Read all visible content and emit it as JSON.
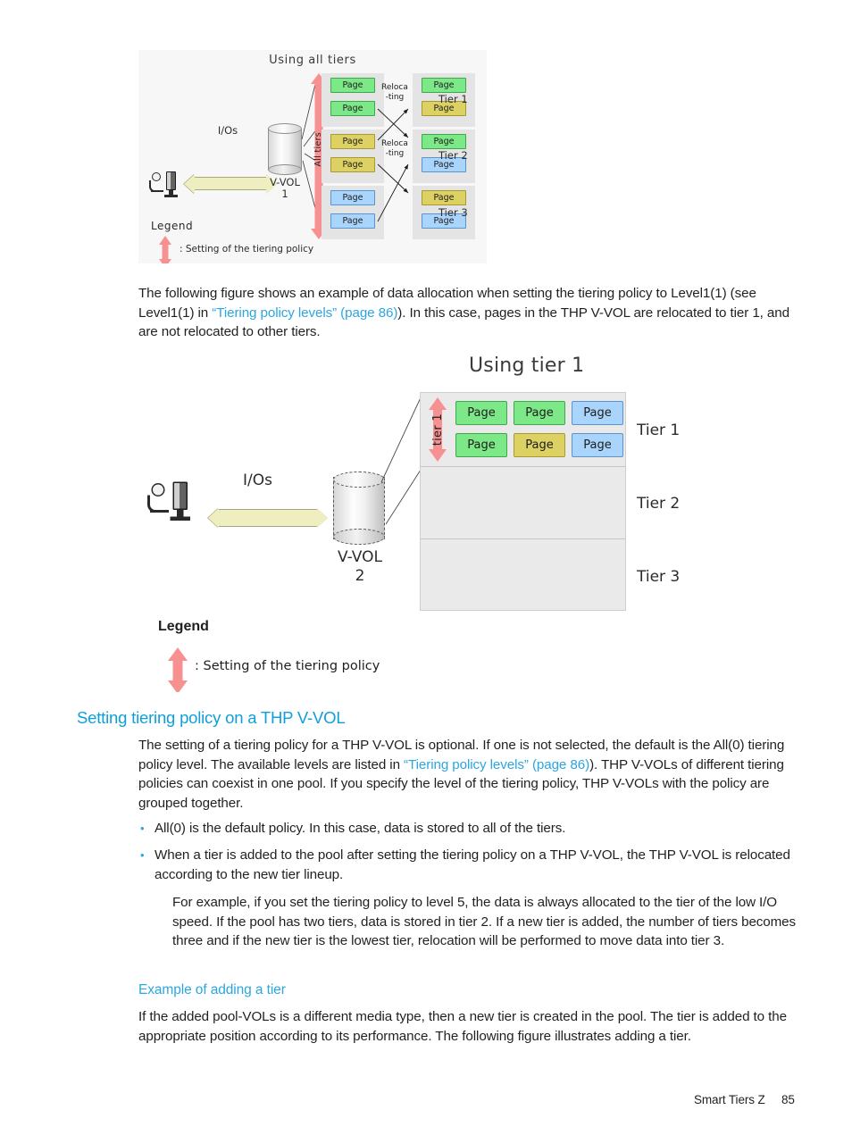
{
  "document": {
    "footer_label": "Smart Tiers Z",
    "page_number": "85"
  },
  "figure1": {
    "title": "Using all tiers",
    "io_label": "I/Os",
    "volume_name": "V-VOL",
    "volume_number": "1",
    "policy_label": "All tiers",
    "relocating_label_1": "Reloca\n-ting",
    "relocating_label_2": "Reloca\n-ting",
    "tier_labels": [
      "Tier 1",
      "Tier 2",
      "Tier 3"
    ],
    "page_label": "Page",
    "left_stack": [
      {
        "tier": 1,
        "pages": [
          {
            "label": "Page",
            "color": "green"
          },
          {
            "label": "Page",
            "color": "green"
          }
        ]
      },
      {
        "tier": 2,
        "pages": [
          {
            "label": "Page",
            "color": "gold"
          },
          {
            "label": "Page",
            "color": "gold"
          }
        ]
      },
      {
        "tier": 3,
        "pages": [
          {
            "label": "Page",
            "color": "blue"
          },
          {
            "label": "Page",
            "color": "blue"
          }
        ]
      }
    ],
    "right_stack": [
      {
        "tier": 1,
        "pages": [
          {
            "label": "Page",
            "color": "green"
          },
          {
            "label": "Page",
            "color": "gold"
          }
        ]
      },
      {
        "tier": 2,
        "pages": [
          {
            "label": "Page",
            "color": "green"
          },
          {
            "label": "Page",
            "color": "blue"
          }
        ]
      },
      {
        "tier": 3,
        "pages": [
          {
            "label": "Page",
            "color": "gold"
          },
          {
            "label": "Page",
            "color": "blue"
          }
        ]
      }
    ],
    "legend_title": "Legend",
    "legend_entry": ": Setting of the tiering policy"
  },
  "figure2": {
    "title": "Using tier 1",
    "io_label": "I/Os",
    "volume_name": "V-VOL",
    "volume_number": "2",
    "policy_label": "tier 1",
    "tier_labels": [
      "Tier 1",
      "Tier 2",
      "Tier 3"
    ],
    "tier1_pages": [
      {
        "label": "Page",
        "color": "green"
      },
      {
        "label": "Page",
        "color": "green"
      },
      {
        "label": "Page",
        "color": "blue"
      },
      {
        "label": "Page",
        "color": "green"
      },
      {
        "label": "Page",
        "color": "gold"
      },
      {
        "label": "Page",
        "color": "blue"
      }
    ],
    "legend_title": "Legend",
    "legend_entry": ": Setting of the tiering policy"
  },
  "paragraphs": {
    "intro_1": "The following figure shows an example of data allocation when setting the tiering policy to Level1(1) (see Level1(1) in ",
    "intro_link": "“Tiering policy levels” (page 86)",
    "intro_2": "). In this case, pages in the THP V-VOL are relocated to tier 1, and are not relocated to other tiers."
  },
  "section": {
    "heading": "Setting tiering policy on a THP V-VOL",
    "body_1": "The setting of a tiering policy for a THP V-VOL is optional. If one is not selected, the default is the All(0) tiering policy level. The available levels are listed in ",
    "body_link": "“Tiering policy levels” (page 86)",
    "body_2": "). THP V-VOLs of different tiering policies can coexist in one pool. If you specify the level of the tiering policy, THP V-VOLs with the policy are grouped together.",
    "bullets": [
      {
        "text": "All(0) is the default policy. In this case, data is stored to all of the tiers."
      },
      {
        "text": "When a tier is added to the pool after setting the tiering policy on a THP V-VOL, the THP V-VOL is relocated according to the new tier lineup."
      }
    ],
    "bullet2_continuation": "For example, if you set the tiering policy to level 5, the data is always allocated to the tier of the low I/O speed. If the pool has two tiers, data is stored in tier 2. If a new tier is added, the number of tiers becomes three and if the new tier is the lowest tier, relocation will be performed to move data into tier 3.",
    "subheading": "Example of adding a tier",
    "sub_body": "If the added pool-VOLs is a different media type, then a new tier is created in the pool. The tier is added to the appropriate position according to its performance. The following figure illustrates adding a tier."
  },
  "colors": {
    "link": "#2ba6e0",
    "heading": "#109fdb",
    "page_green": "#7de887",
    "page_gold": "#ddd164",
    "page_blue": "#a9d4fb",
    "policy_arrow": "#f79191",
    "io_arrow": "#eeeec0"
  }
}
